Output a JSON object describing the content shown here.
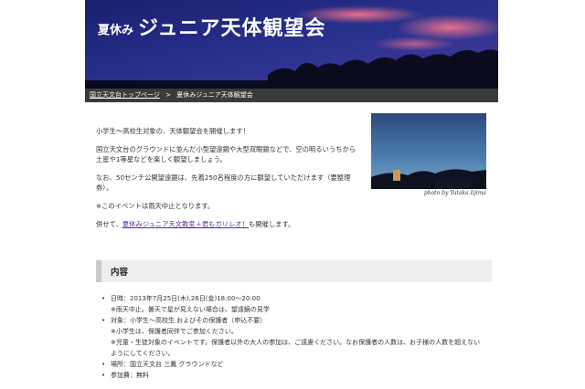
{
  "header": {
    "title_small": "夏休み",
    "title_big": "ジュニア天体観望会"
  },
  "breadcrumb": {
    "home": "国立天文台トップページ",
    "separator": ">",
    "current": "夏休みジュニア天体観望会"
  },
  "intro": {
    "p1": "小学生～高校生対象の、天体観望会を開催します！",
    "p2": "国立天文台のグラウンドに並んだ小型望遠鏡や大型双眼鏡などで、空の明るいうちから土星や1等星などを楽しく観望しましょう。",
    "p3": "なお、50センチ公開望遠鏡は、先着250名程度の方に観望していただけます（要整理券）。",
    "p4": "※このイベントは雨天中止となります。",
    "p5_prefix": "併せて、",
    "p5_link": "夏休みジュニア天文教室＋君もガリレオ！",
    "p5_suffix": "も開催します。"
  },
  "photo": {
    "caption": "photo by Yutaka Iijima"
  },
  "section": {
    "title": "内容"
  },
  "details": {
    "date": "日時：2013年7月25日(木),26日(金)18:00～20:00",
    "date_note": "※雨天中止。曇天で星が見えない場合は、望遠鏡の見学",
    "target": "対象：小学生～高校生 およびその保護者（申込不要）",
    "target_note1": "※小学生は、保護者同伴でご参加ください。",
    "target_note2": "※児童・生徒対象のイベントです。保護者以外の大人の参加は、ご遠慮ください。なお保護者の人数は、お子様の人数を超えないようにしてください。",
    "place": "場所：国立天文台 三鷹 グラウンドなど",
    "fee": "参加費：無料"
  }
}
